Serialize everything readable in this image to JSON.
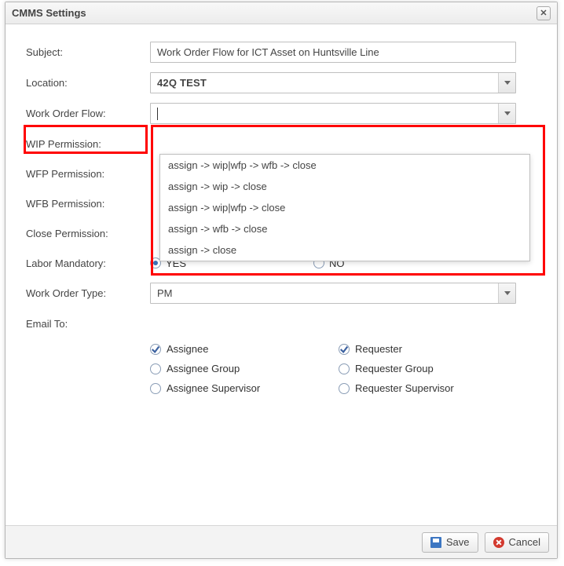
{
  "dialog": {
    "title": "CMMS Settings"
  },
  "labels": {
    "subject": "Subject:",
    "location": "Location:",
    "workOrderFlow": "Work Order Flow:",
    "wipPermission": "WIP Permission:",
    "wfpPermission": "WFP Permission:",
    "wfbPermission": "WFB Permission:",
    "closePermission": "Close Permission:",
    "laborMandatory": "Labor Mandatory:",
    "workOrderType": "Work Order Type:",
    "emailTo": "Email To:"
  },
  "fields": {
    "subject": "Work Order Flow for ICT Asset on Huntsville Line",
    "location": "42Q TEST",
    "workOrderFlow": "",
    "workOrderFlowOptions": [
      "assign -> wip|wfp -> wfb -> close",
      "assign -> wip -> close",
      "assign -> wip|wfp -> close",
      "assign -> wfb -> close",
      "assign -> close"
    ],
    "laborMandatory": {
      "yes": "YES",
      "no": "NO",
      "value": "YES"
    },
    "workOrderType": "PM",
    "emailTo": {
      "assignee": {
        "label": "Assignee",
        "checked": true
      },
      "requester": {
        "label": "Requester",
        "checked": true
      },
      "assigneeGroup": {
        "label": "Assignee Group",
        "checked": false
      },
      "requesterGroup": {
        "label": "Requester Group",
        "checked": false
      },
      "assigneeSupervisor": {
        "label": "Assignee Supervisor",
        "checked": false
      },
      "requesterSupervisor": {
        "label": "Requester Supervisor",
        "checked": false
      }
    }
  },
  "buttons": {
    "save": "Save",
    "cancel": "Cancel"
  }
}
